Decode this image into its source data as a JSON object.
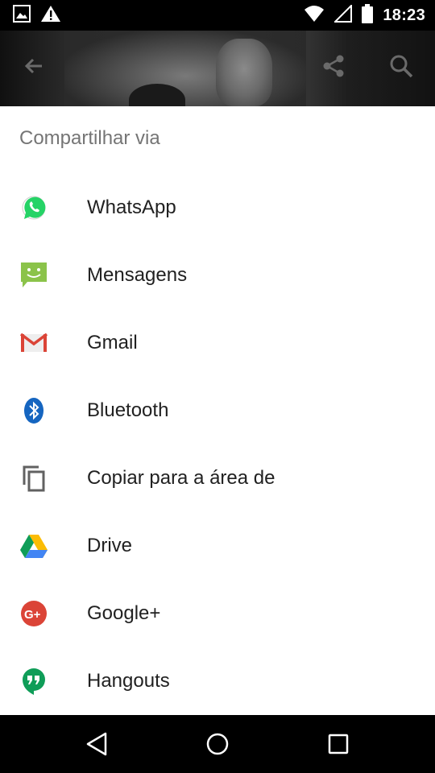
{
  "status_bar": {
    "time": "18:23",
    "icons": [
      "image-notification-icon",
      "warning-icon",
      "wifi-icon",
      "cellular-signal-icon",
      "battery-icon"
    ]
  },
  "app_toolbar": {
    "icons": [
      "back-arrow-icon",
      "share-icon",
      "search-icon"
    ]
  },
  "share_sheet": {
    "title": "Compartilhar via",
    "items": [
      {
        "label": "WhatsApp",
        "icon": "whatsapp-icon",
        "color": "#25D366"
      },
      {
        "label": "Mensagens",
        "icon": "messages-icon",
        "color": "#8BC34A"
      },
      {
        "label": "Gmail",
        "icon": "gmail-icon",
        "color": "#DB4437"
      },
      {
        "label": "Bluetooth",
        "icon": "bluetooth-icon",
        "color": "#1565C0"
      },
      {
        "label": "Copiar para a área de",
        "icon": "copy-icon",
        "color": "#616161"
      },
      {
        "label": "Drive",
        "icon": "drive-icon",
        "color": "#FBBC05"
      },
      {
        "label": "Google+",
        "icon": "google-plus-icon",
        "color": "#DB4437"
      },
      {
        "label": "Hangouts",
        "icon": "hangouts-icon",
        "color": "#0F9D58"
      }
    ]
  },
  "nav_bar": {
    "icons": [
      "back-triangle-icon",
      "home-circle-icon",
      "recents-square-icon"
    ]
  }
}
